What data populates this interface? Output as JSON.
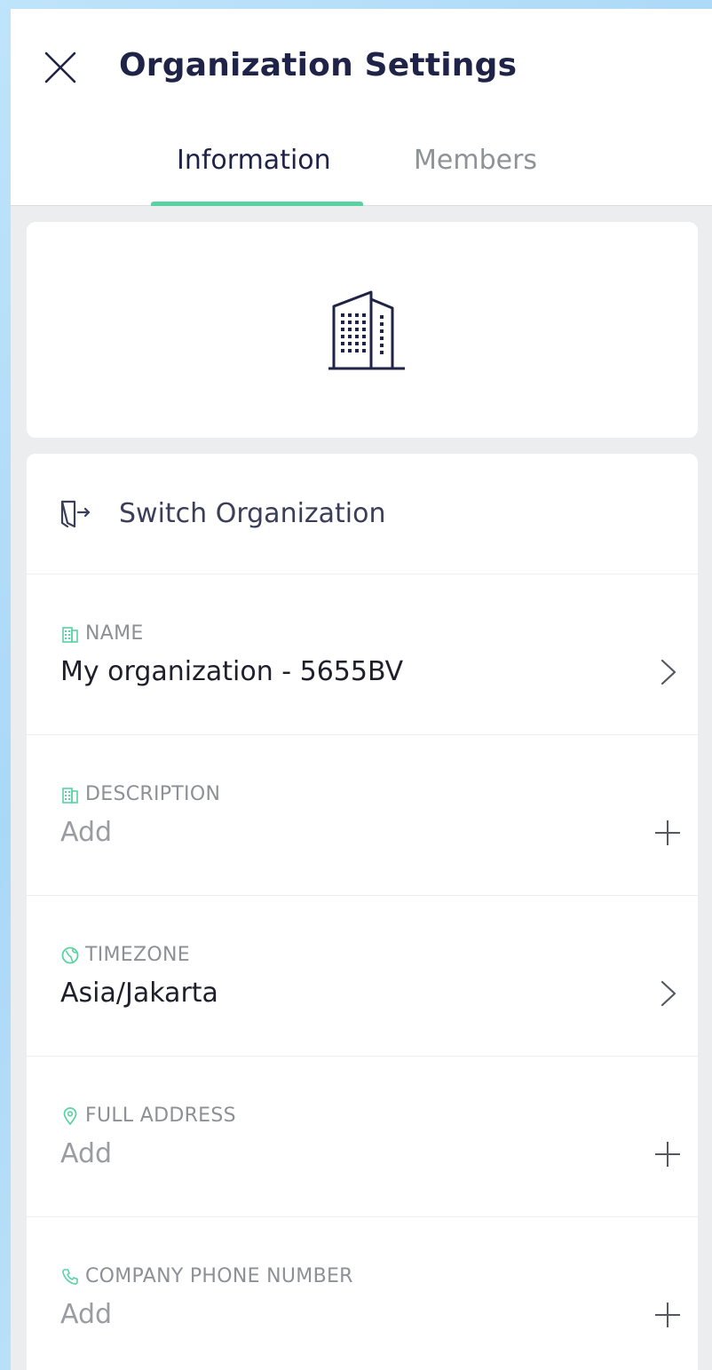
{
  "header": {
    "title": "Organization Settings",
    "close_icon": "close-icon"
  },
  "tabs": [
    {
      "label": "Information",
      "active": true
    },
    {
      "label": "Members",
      "active": false
    }
  ],
  "colors": {
    "accent": "#58d2a3",
    "title": "#1f2347",
    "muted": "#8f9297"
  },
  "logo": {
    "icon": "building-icon"
  },
  "switch_org": {
    "label": "Switch Organization",
    "icon": "switch-door-icon"
  },
  "fields": [
    {
      "label": "NAME",
      "value": "My organization - 5655BV",
      "icon": "building-icon",
      "action": "chevron-right-icon"
    },
    {
      "label": "DESCRIPTION",
      "value": "Add",
      "icon": "building-icon",
      "action": "plus-icon"
    },
    {
      "label": "TIMEZONE",
      "value": "Asia/Jakarta",
      "icon": "globe-icon",
      "action": "chevron-right-icon"
    },
    {
      "label": "FULL ADDRESS",
      "value": "Add",
      "icon": "location-pin-icon",
      "action": "plus-icon"
    },
    {
      "label": "COMPANY PHONE NUMBER",
      "value": "Add",
      "icon": "phone-icon",
      "action": "plus-icon"
    }
  ]
}
